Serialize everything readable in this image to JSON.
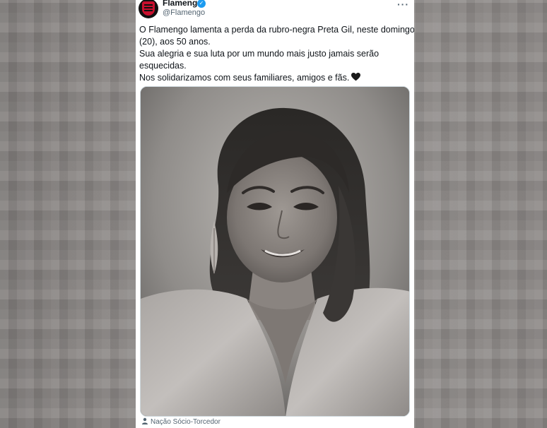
{
  "account": {
    "display_name": "Flamengo",
    "handle": "@Flamengo",
    "verified": true,
    "more_icon": "more-dots-icon"
  },
  "tweet": {
    "lines": [
      "O Flamengo lamenta a perda da rubro-negra Preta Gil, neste domingo",
      "(20), aos 50 anos.",
      "Sua alegria e sua luta por um mundo mais justo jamais serão",
      "esquecidas.",
      "Nos solidarizamos com seus familiares, amigos e fãs."
    ],
    "emoji": "black-heart"
  },
  "media": {
    "type": "photo",
    "description_icon": "portrait-photo"
  },
  "footer": {
    "label": "Nação Sócio-Torcedor",
    "icon": "person-icon"
  },
  "colors": {
    "verified": "#1d9bf0",
    "crest": "#c8102e",
    "text": "#0f1419",
    "muted": "#536471"
  }
}
